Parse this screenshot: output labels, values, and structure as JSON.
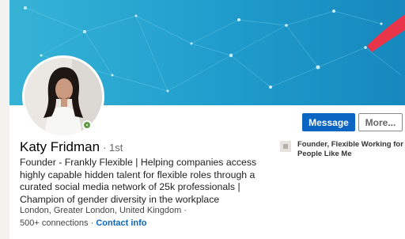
{
  "profile": {
    "name": "Katy Fridman",
    "degree": "· 1st",
    "headline": "Founder - Frankly Flexible | Helping companies access highly capable hidden talent for flexible roles through a curated social media network of 25k professionals | Champion of gender diversity in the workplace",
    "location": "London, Greater London, United Kingdom ·",
    "connections": "500+ connections",
    "separator": "·",
    "contact_info": "Contact info",
    "company": "Founder, Flexible Working for People Like Me"
  },
  "actions": {
    "message_label": "Message",
    "more_label": "More..."
  },
  "colors": {
    "accent": "#0a66c2",
    "banner": "#1f9ccc",
    "online_status": "#5f9b41"
  },
  "icons": {
    "online": "online-status-icon",
    "company": "company-logo-icon"
  }
}
